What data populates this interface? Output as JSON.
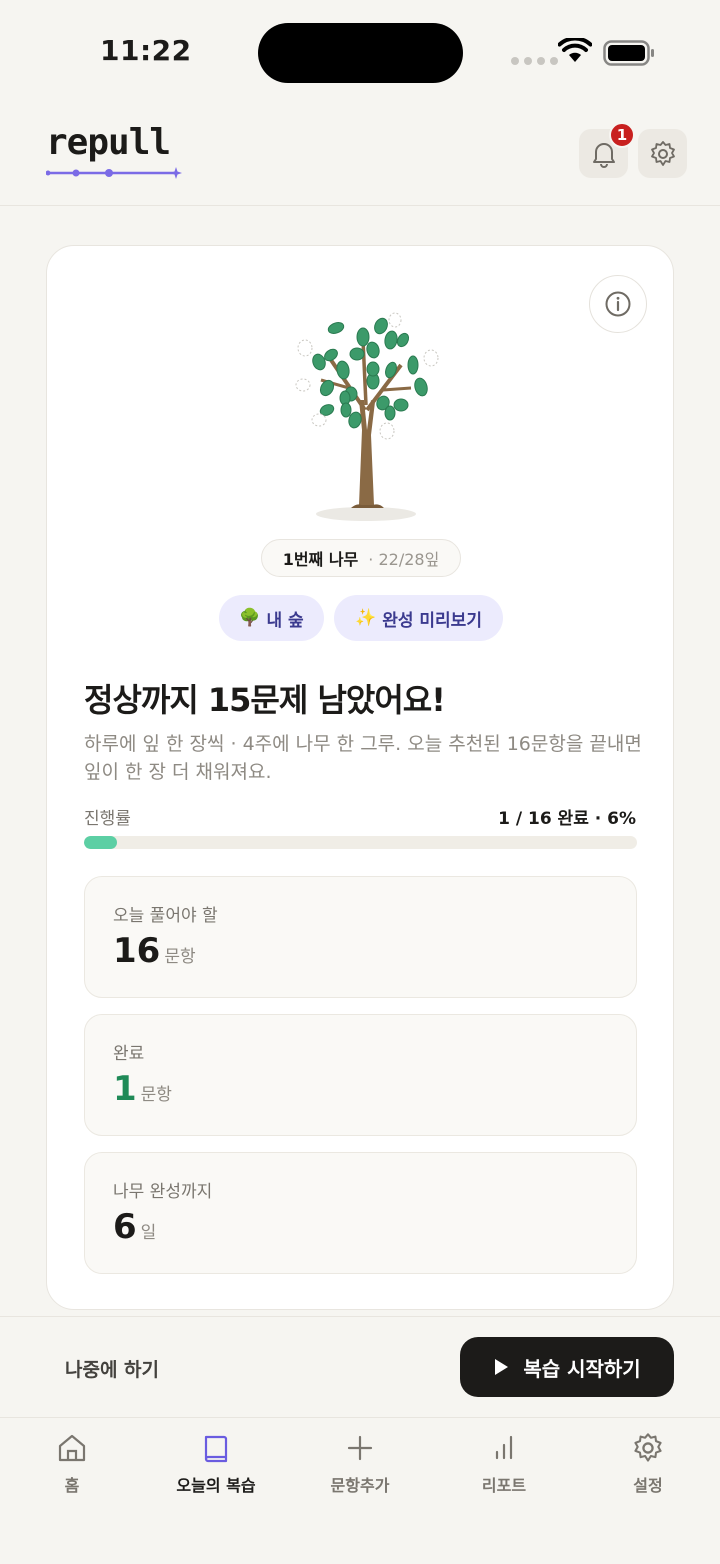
{
  "status_bar": {
    "time": "11:22"
  },
  "header": {
    "logo": "repull",
    "notification_count": "1"
  },
  "card": {
    "tree_pill": {
      "number_label": "1번째 나무",
      "leaves": "· 22/28잎"
    },
    "chips": {
      "forest": "내 숲",
      "forest_emoji": "🌳",
      "preview": "완성 미리보기",
      "preview_emoji": "✨"
    },
    "headline": "정상까지 15문제 남았어요!",
    "subtext": "하루에 잎 한 장씩 · 4주에 나무 한 그루. 오늘 추천된 16문항을 끝내면 잎이 한 장 더 채워져요.",
    "progress": {
      "label": "진행률",
      "value_text": "1 / 16 완료 · 6%",
      "fraction": 0.06
    },
    "stats": [
      {
        "label": "오늘 풀어야 할",
        "value": "16",
        "unit": "문항"
      },
      {
        "label": "완료",
        "value": "1",
        "unit": "문항"
      },
      {
        "label": "나무 완성까지",
        "value": "6",
        "unit": "일"
      }
    ]
  },
  "actions": {
    "later": "나중에 하기",
    "start": "복습 시작하기"
  },
  "tabs": [
    {
      "label": "홈",
      "icon": "home-icon"
    },
    {
      "label": "오늘의 복습",
      "icon": "book-icon"
    },
    {
      "label": "문항추가",
      "icon": "plus-icon"
    },
    {
      "label": "리포트",
      "icon": "bar-chart-icon"
    },
    {
      "label": "설정",
      "icon": "gear-icon"
    }
  ],
  "colors": {
    "accent": "#5ccfa4",
    "brand_purple": "#7b6be6",
    "badge": "#c8201f",
    "done_green": "#1f8a57"
  }
}
